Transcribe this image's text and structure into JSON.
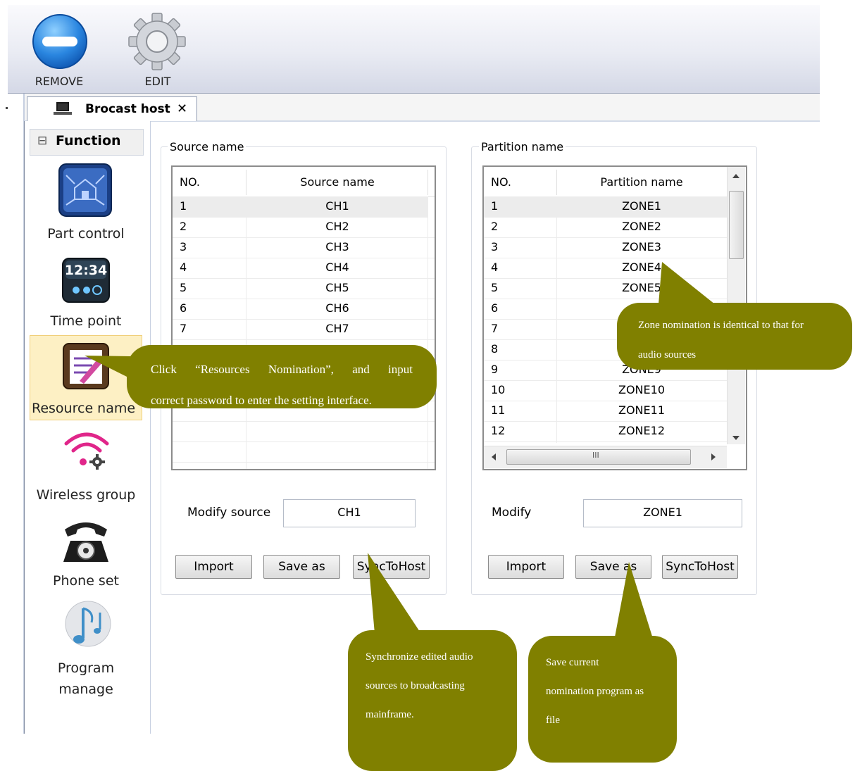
{
  "toolbar": {
    "remove_label": "REMOVE",
    "edit_label": "EDIT"
  },
  "tab": {
    "label": "Brocast host",
    "close": "✕"
  },
  "nav": {
    "header": "Function",
    "collapse_glyph": "⊟",
    "items": [
      {
        "label": "Part control"
      },
      {
        "label": "Time point",
        "clock": "12:34"
      },
      {
        "label": "Resource name"
      },
      {
        "label": "Wireless group"
      },
      {
        "label": "Phone set"
      },
      {
        "label": "Program",
        "label2": "manage"
      }
    ]
  },
  "source": {
    "group_title": "Source name",
    "columns": [
      "NO.",
      "Source name"
    ],
    "rows": [
      {
        "no": "1",
        "name": "CH1"
      },
      {
        "no": "2",
        "name": "CH2"
      },
      {
        "no": "3",
        "name": "CH3"
      },
      {
        "no": "4",
        "name": "CH4"
      },
      {
        "no": "5",
        "name": "CH5"
      },
      {
        "no": "6",
        "name": "CH6"
      },
      {
        "no": "7",
        "name": "CH7"
      }
    ],
    "modify_label": "Modify source",
    "modify_value": "CH1",
    "buttons": {
      "import": "Import",
      "save_as": "Save as",
      "sync": "SyncToHost"
    }
  },
  "partition": {
    "group_title": "Partition name",
    "columns": [
      "NO.",
      "Partition name"
    ],
    "rows": [
      {
        "no": "1",
        "name": "ZONE1"
      },
      {
        "no": "2",
        "name": "ZONE2"
      },
      {
        "no": "3",
        "name": "ZONE3"
      },
      {
        "no": "4",
        "name": "ZONE4"
      },
      {
        "no": "5",
        "name": "ZONE5"
      },
      {
        "no": "6",
        "name": ""
      },
      {
        "no": "7",
        "name": ""
      },
      {
        "no": "8",
        "name": ""
      },
      {
        "no": "9",
        "name": "ZONE9"
      },
      {
        "no": "10",
        "name": "ZONE10"
      },
      {
        "no": "11",
        "name": "ZONE11"
      },
      {
        "no": "12",
        "name": "ZONE12"
      }
    ],
    "modify_label": "Modify",
    "modify_value": "ZONE1",
    "buttons": {
      "import": "Import",
      "save_as": "Save as",
      "sync": "SyncToHost"
    },
    "hscroll_grip": "III"
  },
  "callouts": {
    "resources_line1": "Click “Resources Nomination”, and input",
    "resources_line2": "correct password to enter the setting interface.",
    "zone_line1": "Zone nomination is identical to that for",
    "zone_line2": "audio sources",
    "sync_line1": "Synchronize edited audio",
    "sync_line2": "sources to broadcasting",
    "sync_line3": "mainframe.",
    "save_line1": "Save current",
    "save_line2": "nomination program as",
    "save_line3": "file"
  },
  "colors": {
    "callout": "#808000",
    "selected_nav": "#fdf0c4"
  }
}
